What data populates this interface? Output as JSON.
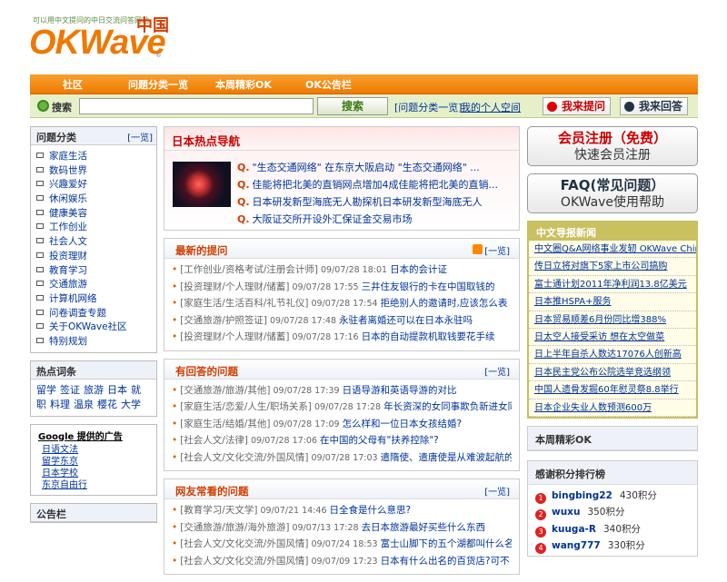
{
  "header": {
    "tagline": "可以用中文提问的中日交流问答网站",
    "logo": "OKWave",
    "logo_cn": "中国",
    "logo_reg": "®"
  },
  "nav": {
    "items": [
      "社区",
      "问题分类一览",
      "本周精彩OK",
      "OK公告栏"
    ]
  },
  "search": {
    "label": "搜索",
    "button": "搜索",
    "placeholder": "",
    "link1": "[问题分类一览]",
    "link2": "我的个人空间",
    "ask": "我来提问",
    "answer": "我来回答"
  },
  "categories": {
    "title": "问题分类",
    "more": "[一览]",
    "items": [
      "家庭生活",
      "数码世界",
      "兴趣爱好",
      "休闲娱乐",
      "健康美容",
      "工作创业",
      "社会人文",
      "投资理财",
      "教育学习",
      "交通旅游",
      "计算机网络",
      "问卷调查专题",
      "关于OKWave社区",
      "特别规划"
    ]
  },
  "hotwords": {
    "title": "热点词条",
    "words": [
      "留学",
      "签证",
      "旅游",
      "日本",
      "就职",
      "料理",
      "温泉",
      "樱花",
      "大学"
    ]
  },
  "google": {
    "head": "Google 提供的广告",
    "items": [
      "日语文法",
      "留学东京",
      "日本学校",
      "东京自由行"
    ]
  },
  "notice": {
    "title": "公告栏"
  },
  "hotnav": {
    "title": "日本热点导航",
    "items": [
      "\"生态交通网络\" 在东京大阪启动 \"生态交通网络\" ...",
      "佳能将把北美的直销网点增加4成佳能将把北美的直销...",
      "日本研发新型海底无人勘探机日本研发新型海底无人",
      "大阪证交所开设外汇保证金交易市场"
    ]
  },
  "latest": {
    "title": "最新的提问",
    "more": "[一览]",
    "items": [
      {
        "cat": "[工作创业/资格考试/注册会计师]",
        "time": "09/07/28 18:01",
        "title": "日本的会计证"
      },
      {
        "cat": "[投资理财/个人理财/储蓄]",
        "time": "09/07/28 17:55",
        "title": "三井住友银行的卡在中国取钱的"
      },
      {
        "cat": "[家庭生活/生活百科/礼节礼仪]",
        "time": "09/07/28 17:54",
        "title": "拒绝别人的邀请时,应该怎么表"
      },
      {
        "cat": "[交通旅游/护照签证]",
        "time": "09/07/28 17:48",
        "title": "永驻者离婚还可以在日本永驻吗"
      },
      {
        "cat": "[投资理财/个人理财/储蓄]",
        "time": "09/07/28 17:16",
        "title": "日本的自动提款机取钱要花手续"
      }
    ]
  },
  "answered": {
    "title": "有回答的问题",
    "more": "[一览]",
    "items": [
      {
        "cat": "[交通旅游/旅游/其他]",
        "time": "09/07/28 17:39",
        "title": "日语导游和英语导游的对比"
      },
      {
        "cat": "[家庭生活/恋爱/人生/职场关系]",
        "time": "09/07/28 17:28",
        "title": "年长资深的女同事欺负新进女同"
      },
      {
        "cat": "[家庭生活/结婚/其他]",
        "time": "09/07/28 17:09",
        "title": "怎么样和一位日本女孩结婚?"
      },
      {
        "cat": "[社会人文/法律]",
        "time": "09/07/28 17:06",
        "title": "在中国的父母有\"扶养控除\"?"
      },
      {
        "cat": "[社会人文/文化交流/外国风情]",
        "time": "09/07/28 17:03",
        "title": "遣隋使、遣唐使是从难波起航的"
      }
    ]
  },
  "popular": {
    "title": "网友常看的问题",
    "more": "[一览]",
    "items": [
      {
        "cat": "[教育学习/天文学]",
        "time": "09/07/21 14:46",
        "title": "日全食是什么意思?"
      },
      {
        "cat": "[交通旅游/旅游/海外旅游]",
        "time": "09/07/13 17:28",
        "title": "去日本旅游最好买些什么东西"
      },
      {
        "cat": "[社会人文/文化交流/外国风情]",
        "time": "09/07/24 18:53",
        "title": "富士山脚下的五个湖都叫什么名"
      },
      {
        "cat": "[社会人文/文化交流/外国风情]",
        "time": "09/07/09 17:23",
        "title": "日本有什么出名的百货店?可不"
      }
    ]
  },
  "register": {
    "l1": "会员注册（免费）",
    "l2": "快速会员注册"
  },
  "faq": {
    "l1": "FAQ(常见问题）",
    "l2": "OKWave使用帮助"
  },
  "news": {
    "title": "中文导报新闻",
    "items": [
      "中文圈Q&A网络事业发轫 OKWave China正式公开",
      "传日立将对旗下5家上市公司搞购",
      "富士通计划2011年净利润13.8亿美元",
      "日本推HSPA+服务",
      "日本贸易顺差6月份同比增388%",
      "日太空人接受采访 想在太空做菜",
      "日上半年自杀人数达17076人创新高",
      "日本民主党公布公院选举竞选纲领",
      "中国人遗骨发掘60年慰灵祭8.8举行",
      "日本企业失业人数预测600万"
    ]
  },
  "weekly": {
    "title": "本周精彩OK"
  },
  "rank": {
    "title": "感谢积分排行榜",
    "items": [
      {
        "no": "1",
        "user": "bingbing22",
        "points": "430积分"
      },
      {
        "no": "2",
        "user": "wuxu",
        "points": "350积分"
      },
      {
        "no": "3",
        "user": "kuuga-R",
        "points": "340积分"
      },
      {
        "no": "4",
        "user": "wang777",
        "points": "330积分"
      }
    ]
  },
  "colors": {
    "brand_orange": "#f07800",
    "nav_orange": "#ee7a00",
    "search_green": "#e6f0c8",
    "news_olive": "#c9c060",
    "link_blue": "#003399",
    "accent_red": "#cc0000"
  }
}
